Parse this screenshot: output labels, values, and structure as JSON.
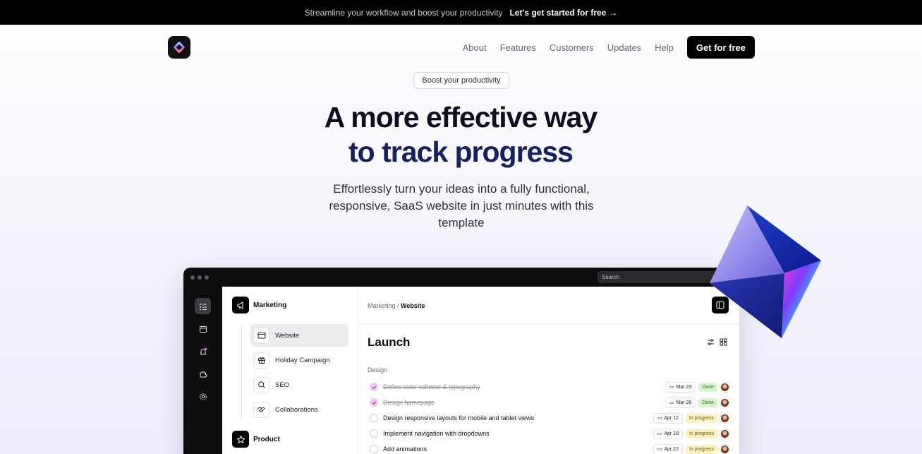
{
  "announcement": {
    "text": "Streamline your workflow and boost your productivity",
    "cta": "Let's get started for free"
  },
  "nav": {
    "links": [
      "About",
      "Features",
      "Customers",
      "Updates",
      "Help"
    ],
    "cta": "Get for free"
  },
  "hero": {
    "pill": "Boost your productivity",
    "title_line1": "A more effective way",
    "title_line2": "to track progress",
    "subtitle": "Effortlessly turn your ideas into a fully functional, responsive, SaaS website in just minutes with this template"
  },
  "app": {
    "search_placeholder": "Search",
    "sidebar": {
      "group1": "Marketing",
      "items": [
        "Website",
        "Holiday Campaign",
        "SEO",
        "Collaborations"
      ],
      "group2": "Product"
    },
    "breadcrumb": {
      "parent": "Marketing",
      "separator": " / ",
      "current": "Website"
    },
    "page_title": "Launch",
    "section": "Design",
    "tasks": [
      {
        "text": "Define color scheme & typography",
        "date": "Mar 23",
        "status": "Done"
      },
      {
        "text": "Design homepage",
        "date": "Mar 28",
        "status": "Done"
      },
      {
        "text": "Design responsive layouts for mobile and tablet views",
        "date": "Apr 12",
        "status": "In progress"
      },
      {
        "text": "Implement navigation with dropdowns",
        "date": "Apr 18",
        "status": "In progress"
      },
      {
        "text": "Add animations",
        "date": "Apr 22",
        "status": "In progress"
      }
    ]
  },
  "colors": {
    "title_dark": "#0e0e22",
    "title_navy": "#172061",
    "done_badge": "#d9f5d0",
    "progress_badge": "#fdf0c2",
    "check_done": "#f0c8f5"
  }
}
